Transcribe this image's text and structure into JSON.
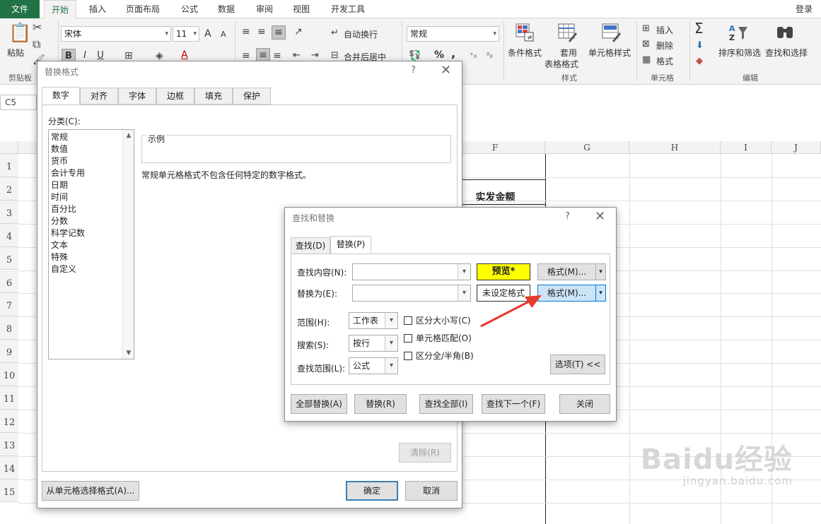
{
  "ribbon": {
    "file_tab": "文件",
    "tabs": [
      "开始",
      "插入",
      "页面布局",
      "公式",
      "数据",
      "审阅",
      "视图",
      "开发工具"
    ],
    "login": "登录",
    "clipboard": {
      "paste": "粘贴",
      "group": "剪贴板"
    },
    "font": {
      "name": "宋体",
      "size": "11",
      "bold": "B",
      "italic": "I",
      "underline": "U",
      "grow": "A",
      "shrink": "A",
      "font_color": "A"
    },
    "align": {
      "wrap": "自动换行",
      "merge": "合并后居中"
    },
    "number": {
      "format": "常规",
      "percent": "%",
      "comma": ","
    },
    "styles": {
      "conditional": "条件格式",
      "table_line1": "套用",
      "table_line2": "表格格式",
      "cell_styles": "单元格样式",
      "group": "样式"
    },
    "cells": {
      "insert": "插入",
      "delete": "删除",
      "format": "格式",
      "group": "单元格"
    },
    "editing": {
      "sort": "排序和筛选",
      "find": "查找和选择",
      "group": "编辑",
      "sigma": "Σ"
    }
  },
  "namebox": "C5",
  "sheet": {
    "columns": [
      "F",
      "G",
      "H",
      "I",
      "J"
    ],
    "rows": [
      "1",
      "2",
      "3",
      "4",
      "5",
      "6",
      "7",
      "8",
      "9",
      "10",
      "11",
      "12",
      "13",
      "14",
      "15"
    ],
    "cell_f2": "实发金额"
  },
  "replace_format_dialog": {
    "title": "替换格式",
    "help": "?",
    "tabs": [
      "数字",
      "对齐",
      "字体",
      "边框",
      "填充",
      "保护"
    ],
    "category_label": "分类(C):",
    "categories": [
      "常规",
      "数值",
      "货币",
      "会计专用",
      "日期",
      "时间",
      "百分比",
      "分数",
      "科学记数",
      "文本",
      "特殊",
      "自定义"
    ],
    "sample_label": "示例",
    "description": "常规单元格格式不包含任何特定的数字格式。",
    "clear": "清除(R)",
    "from_cell": "从单元格选择格式(A)...",
    "ok": "确定",
    "cancel": "取消"
  },
  "find_replace_dialog": {
    "title": "查找和替换",
    "help": "?",
    "tabs": [
      "查找(D)",
      "替换(P)"
    ],
    "find_label": "查找内容(N):",
    "replace_label": "替换为(E):",
    "find_value": "",
    "replace_value": "",
    "preview": "预览*",
    "unset": "未设定格式",
    "format_button": "格式(M)...",
    "scope_label": "范围(H):",
    "scope_value": "工作表",
    "search_label": "搜索(S):",
    "search_value": "按行",
    "lookin_label": "查找范围(L):",
    "lookin_value": "公式",
    "match_case": "区分大小写(C)",
    "match_cell": "单元格匹配(O)",
    "match_width": "区分全/半角(B)",
    "options": "选项(T) <<",
    "replace_all": "全部替换(A)",
    "replace": "替换(R)",
    "find_all": "查找全部(I)",
    "find_next": "查找下一个(F)",
    "close": "关闭"
  },
  "watermark": {
    "logo": "Baidu经验",
    "site": "jingyan.baidu.com"
  },
  "colors": {
    "excel_green": "#217346",
    "preview_yellow": "#ffff00",
    "highlight_blue": "#cce4f7",
    "arrow_red": "#e8392f"
  }
}
